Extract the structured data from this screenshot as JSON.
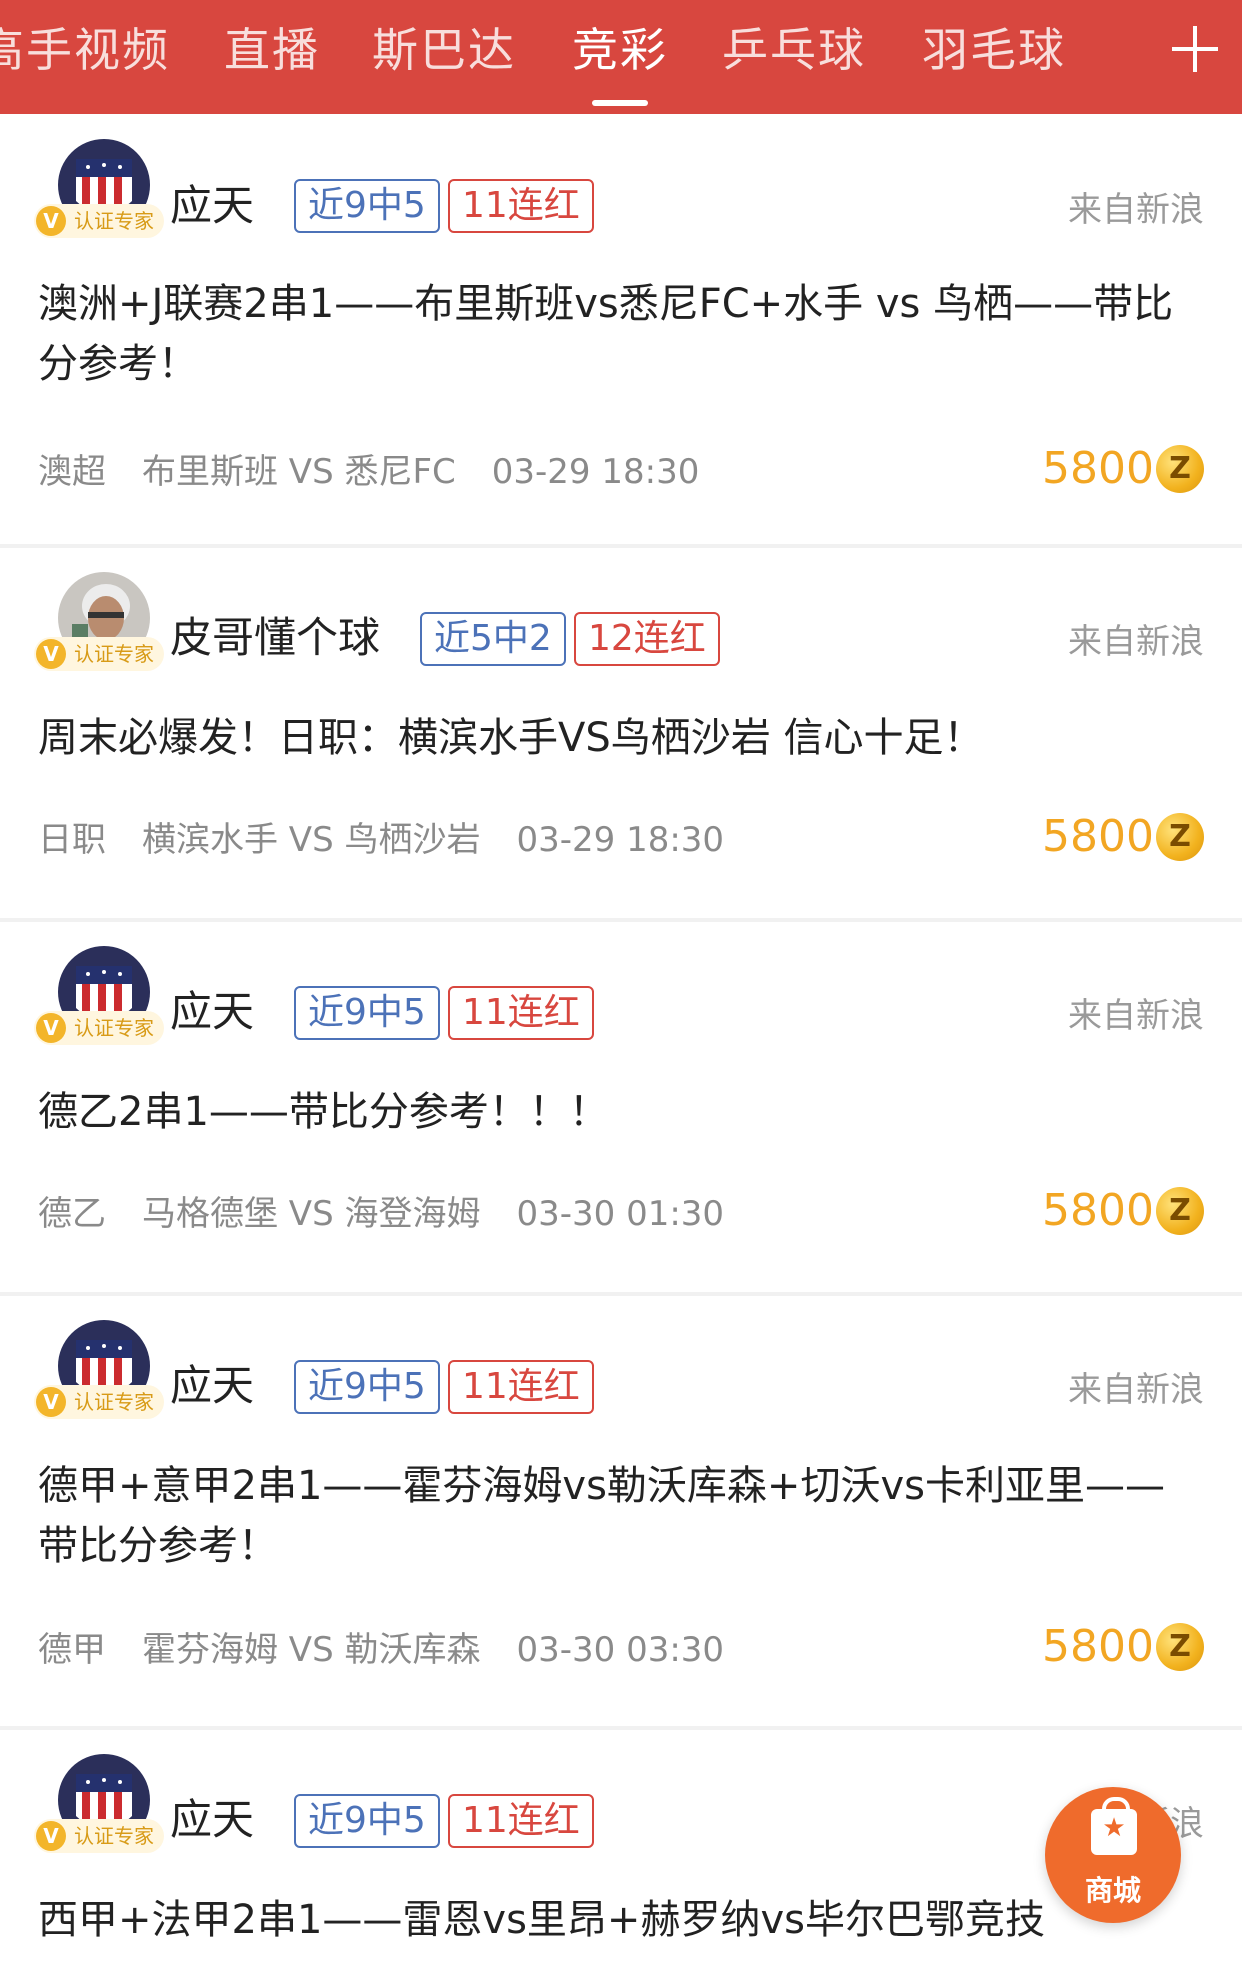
{
  "tabs": [
    {
      "label": "高手视频",
      "active": false
    },
    {
      "label": "直播",
      "active": false
    },
    {
      "label": "斯巴达",
      "active": false
    },
    {
      "label": "竞彩",
      "active": true
    },
    {
      "label": "乒乓球",
      "active": false
    },
    {
      "label": "羽毛球",
      "active": false
    }
  ],
  "add_tab_icon": "plus-icon",
  "colors": {
    "header_bg": "#d8473f",
    "record_tag": "#4c72b8",
    "streak_tag": "#d8473f",
    "price": "#f2a623",
    "mall_button": "#ef6b2c"
  },
  "posts": [
    {
      "user": "应天",
      "avatar": "club-crest-avatar",
      "badge": "认证专家",
      "record": "近9中5",
      "streak": "11连红",
      "source": "来自新浪",
      "title": "澳洲+J联赛2串1——布里斯班vs悉尼FC+水手 vs 鸟栖——带比分参考！",
      "league": "澳超",
      "match": "布里斯班 VS 悉尼FC",
      "time": "03-29 18:30",
      "price": "5800",
      "coin": "Z"
    },
    {
      "user": "皮哥懂个球",
      "avatar": "person-photo-avatar",
      "badge": "认证专家",
      "record": "近5中2",
      "streak": "12连红",
      "source": "来自新浪",
      "title": "周末必爆发！日职：横滨水手VS鸟栖沙岩 信心十足！",
      "league": "日职",
      "match": "横滨水手 VS 鸟栖沙岩",
      "time": "03-29 18:30",
      "price": "5800",
      "coin": "Z"
    },
    {
      "user": "应天",
      "avatar": "club-crest-avatar",
      "badge": "认证专家",
      "record": "近9中5",
      "streak": "11连红",
      "source": "来自新浪",
      "title": "德乙2串1——带比分参考！！！",
      "league": "德乙",
      "match": "马格德堡 VS 海登海姆",
      "time": "03-30 01:30",
      "price": "5800",
      "coin": "Z"
    },
    {
      "user": "应天",
      "avatar": "club-crest-avatar",
      "badge": "认证专家",
      "record": "近9中5",
      "streak": "11连红",
      "source": "来自新浪",
      "title": "德甲+意甲2串1——霍芬海姆vs勒沃库森+切沃vs卡利亚里——带比分参考！",
      "league": "德甲",
      "match": "霍芬海姆 VS 勒沃库森",
      "time": "03-30 03:30",
      "price": "5800",
      "coin": "Z"
    },
    {
      "user": "应天",
      "avatar": "club-crest-avatar",
      "badge": "认证专家",
      "record": "近9中5",
      "streak": "11连红",
      "source": "来自新浪",
      "title": "西甲+法甲2串1——雷恩vs里昂+赫罗纳vs毕尔巴鄂竞技"
    }
  ],
  "mall": {
    "label": "商城",
    "icon": "shopping-bag-icon"
  }
}
